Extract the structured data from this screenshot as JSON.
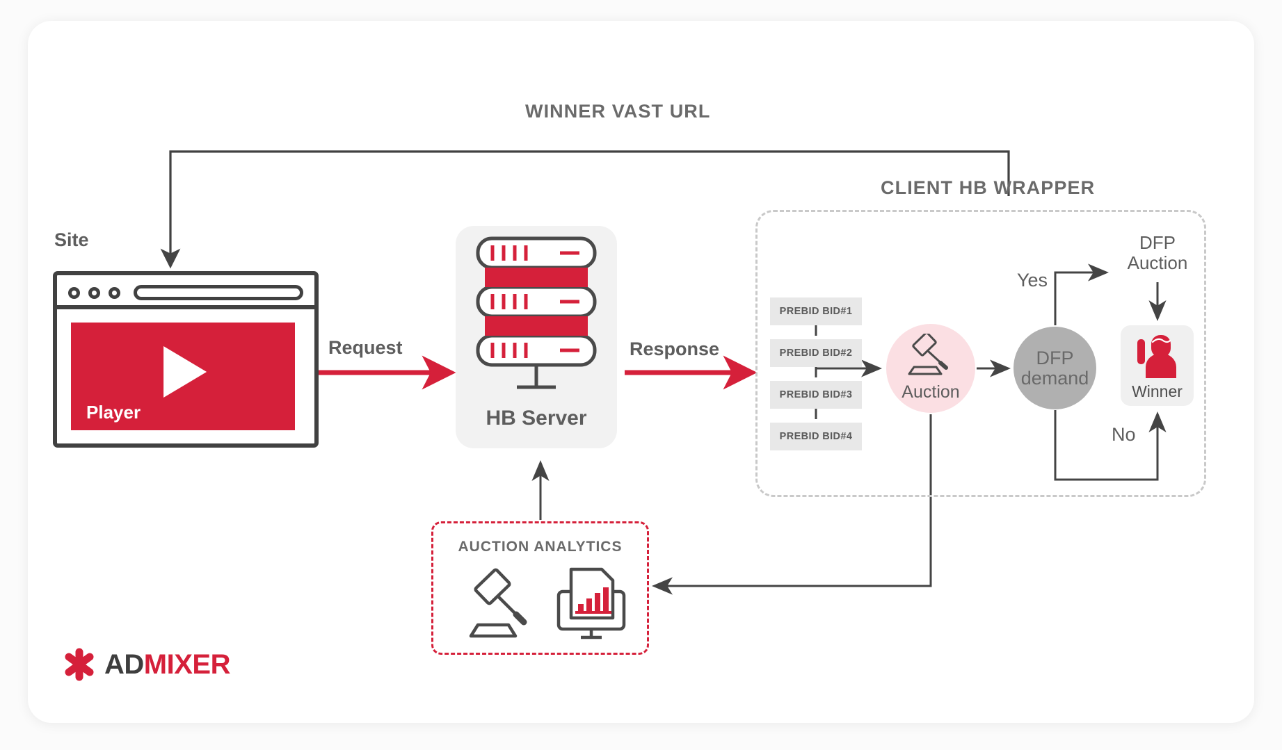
{
  "diagram": {
    "title_top": "WINNER VAST URL",
    "wrapper_title": "CLIENT HB WRAPPER",
    "site_label": "Site",
    "player_label": "Player",
    "hb_server_label": "HB Server",
    "request_label": "Request",
    "response_label": "Response",
    "analytics_title": "AUCTION ANALYTICS",
    "auction_label": "Auction",
    "dfp_demand_line1": "DFP",
    "dfp_demand_line2": "demand",
    "dfp_auction_line1": "DFP",
    "dfp_auction_line2": "Auction",
    "winner_label": "Winner",
    "yes_label": "Yes",
    "no_label": "No",
    "bids": [
      {
        "label": "PREBID BID#1"
      },
      {
        "label": "PREBID BID#2"
      },
      {
        "label": "PREBID BID#3"
      },
      {
        "label": "PREBID BID#4"
      }
    ]
  },
  "logo": {
    "part1": "AD",
    "part2": "MIXER",
    "mark": "asterisk-icon"
  },
  "colors": {
    "brand_red": "#D5203A",
    "text_gray": "#5d5d5d",
    "muted_gray": "#6a6a6a",
    "dark_stroke": "#414141",
    "box_gray": "#e8e8e8",
    "auction_pink": "#fbdfe3",
    "dfp_gray": "#b0b0b0",
    "card_gray": "#f2f2f2"
  },
  "icons": {
    "server": "server-rack-icon",
    "play": "play-triangle-icon",
    "gavel": "gavel-icon",
    "monitor_chart": "monitor-chart-icon",
    "person": "person-winner-icon"
  }
}
